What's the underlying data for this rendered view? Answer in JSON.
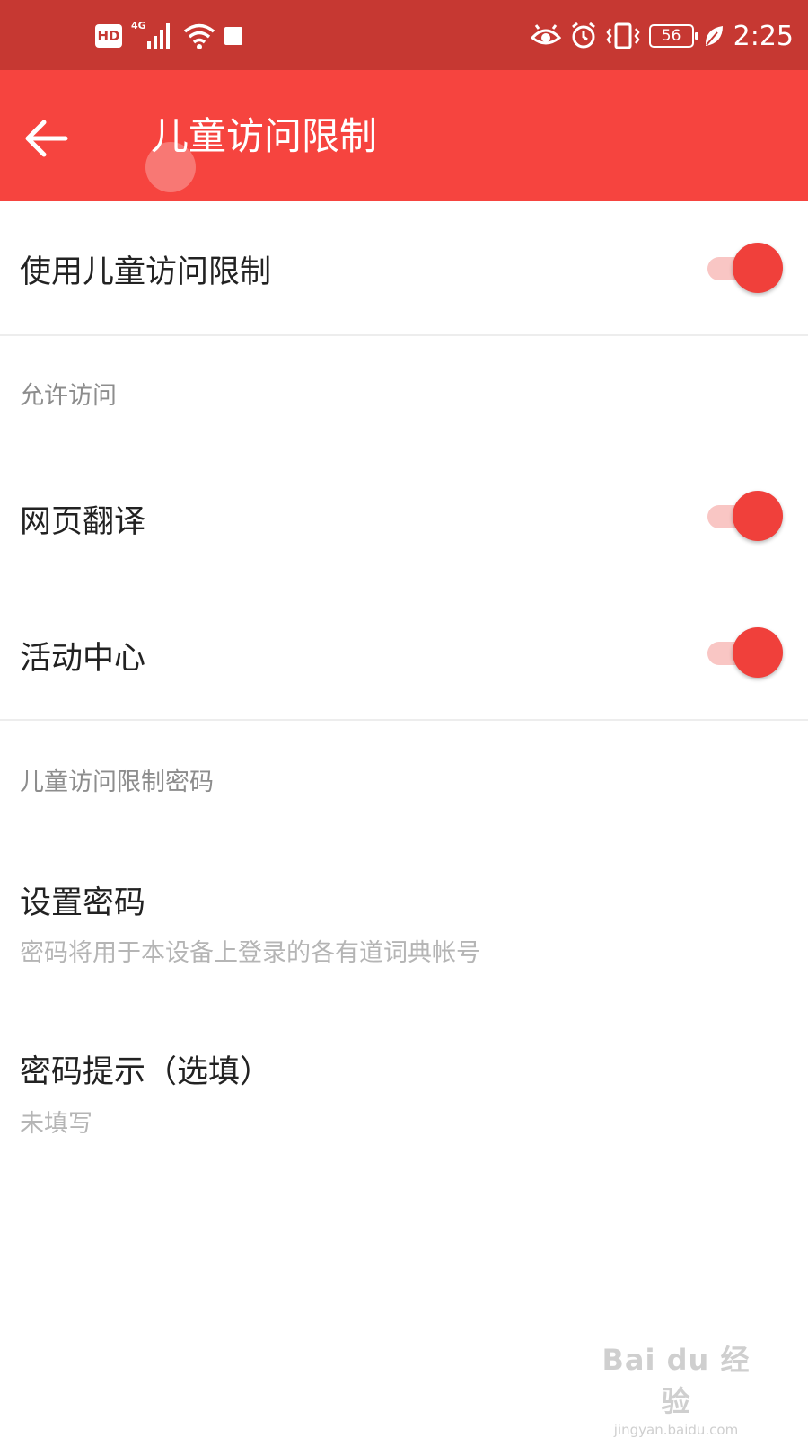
{
  "status_bar": {
    "hd": "HD",
    "network": "4G",
    "battery": "56",
    "time": "2:25",
    "icons": [
      "hd-icon",
      "signal-icon",
      "wifi-icon",
      "notification-square-icon",
      "eye-icon",
      "alarm-icon",
      "vibrate-icon",
      "battery-icon",
      "leaf-icon"
    ]
  },
  "app_bar": {
    "back_icon": "arrow-left-icon",
    "title": "儿童访问限制"
  },
  "settings": {
    "use_restriction": {
      "label": "使用儿童访问限制",
      "enabled": true
    },
    "allow_section": {
      "header": "允许访问"
    },
    "web_translate": {
      "label": "网页翻译",
      "enabled": true
    },
    "activity_center": {
      "label": "活动中心",
      "enabled": true
    },
    "password_section": {
      "header": "儿童访问限制密码"
    },
    "set_password": {
      "label": "设置密码",
      "description": "密码将用于本设备上登录的各有道词典帐号"
    },
    "password_hint": {
      "label": "密码提示（选填）",
      "value": "未填写"
    }
  },
  "colors": {
    "status_bar": "#c63832",
    "app_bar": "#f6443f",
    "accent": "#f0403b",
    "track": "#f9c6c4"
  },
  "watermark": {
    "logo": "Bai du 经验",
    "url": "jingyan.baidu.com"
  }
}
